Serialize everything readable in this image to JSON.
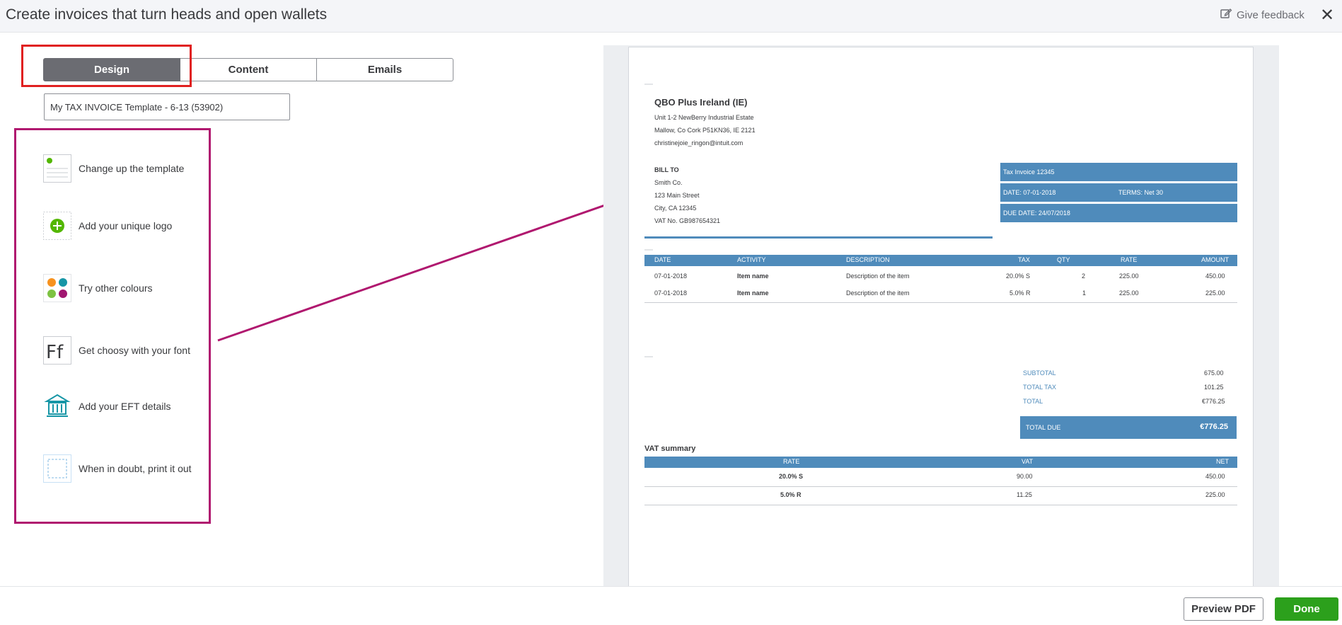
{
  "header": {
    "title": "Create invoices that turn heads and open wallets",
    "feedback_label": "Give feedback",
    "close_icon": "close-icon"
  },
  "tabs": [
    {
      "label": "Design",
      "active": true
    },
    {
      "label": "Content",
      "active": false
    },
    {
      "label": "Emails",
      "active": false
    }
  ],
  "template_name": "My TAX INVOICE Template - 6-13 (53902)",
  "design_options": [
    {
      "label": "Change up the template",
      "icon": "template-icon"
    },
    {
      "label": "Add your unique logo",
      "icon": "add-logo-icon"
    },
    {
      "label": "Try other colours",
      "icon": "colour-palette-icon"
    },
    {
      "label": "Get choosy with your font",
      "icon": "font-icon"
    },
    {
      "label": "Add your EFT details",
      "icon": "bank-icon"
    },
    {
      "label": "When in doubt, print it out",
      "icon": "print-margins-icon"
    }
  ],
  "colors": {
    "accent": "#4f8bbb",
    "red_highlight": "#e02020",
    "magenta_highlight": "#b0186f",
    "done_green": "#2ca01c",
    "dot_orange": "#f7921e",
    "dot_teal": "#1796a6",
    "dot_green": "#7dc242",
    "dot_purple": "#a01770"
  },
  "invoice": {
    "company_name": "QBO Plus Ireland (IE)",
    "address_line1": "Unit 1-2 NewBerry Industrial Estate",
    "address_line2": "Mallow, Co Cork P51KN36, IE 2121",
    "email": "christinejoie_ringon@intuit.com",
    "bill_to_label": "BILL TO",
    "bill_to_name": "Smith Co.",
    "bill_to_street": "123 Main Street",
    "bill_to_city": "City, CA 12345",
    "bill_to_vat": "VAT No.  GB987654321",
    "tax_invoice": "Tax Invoice  12345",
    "date": "DATE:  07-01-2018",
    "terms": "TERMS: Net 30",
    "due_date": "DUE DATE: 24/07/2018",
    "columns": [
      "DATE",
      "ACTIVITY",
      "DESCRIPTION",
      "TAX",
      "QTY",
      "RATE",
      "AMOUNT"
    ],
    "rows": [
      [
        "07-01-2018",
        "Item name",
        "Description of the item",
        "20.0% S",
        "2",
        "225.00",
        "450.00"
      ],
      [
        "07-01-2018",
        "Item name",
        "Description of the item",
        "5.0% R",
        "1",
        "225.00",
        "225.00"
      ]
    ],
    "subtotal_label": "SUBTOTAL",
    "subtotal_value": "675.00",
    "total_tax_label": "TOTAL TAX",
    "total_tax_value": "101.25",
    "total_label": "TOTAL",
    "total_value": "€776.25",
    "total_due_label": "TOTAL DUE",
    "total_due_value": "€776.25",
    "vat_summary_title": "VAT summary",
    "vat_columns": [
      "RATE",
      "VAT",
      "NET"
    ],
    "vat_rows": [
      [
        "20.0% S",
        "90.00",
        "450.00"
      ],
      [
        "5.0% R",
        "11.25",
        "225.00"
      ]
    ]
  },
  "footer": {
    "preview_label": "Preview PDF",
    "done_label": "Done"
  }
}
